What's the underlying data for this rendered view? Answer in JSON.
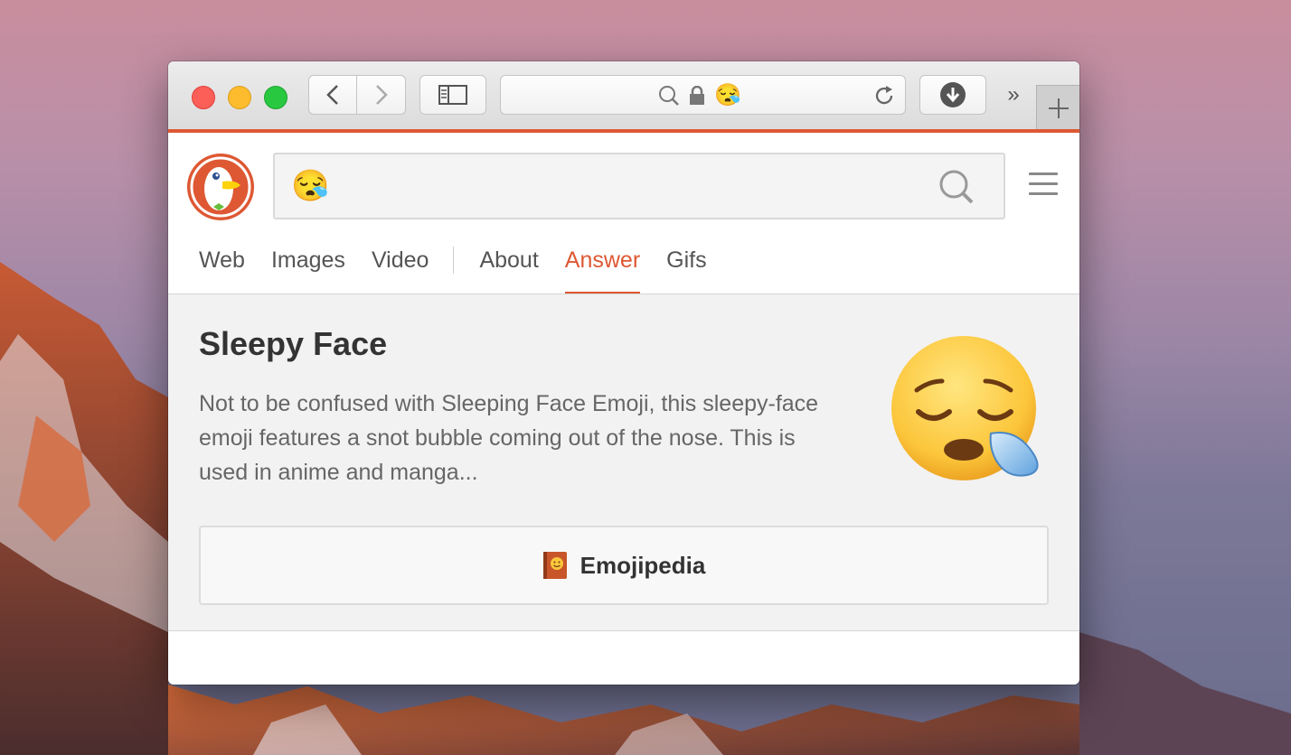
{
  "toolbar": {
    "address_emoji": "😪",
    "overflow_glyph": "»"
  },
  "search": {
    "query": "😪"
  },
  "tabs": [
    {
      "label": "Web",
      "active": false
    },
    {
      "label": "Images",
      "active": false
    },
    {
      "label": "Video",
      "active": false
    },
    {
      "label": "About",
      "active": false
    },
    {
      "label": "Answer",
      "active": true
    },
    {
      "label": "Gifs",
      "active": false
    }
  ],
  "answer": {
    "title": "Sleepy Face",
    "description": "Not to be confused with Sleeping Face Emoji, this sleepy-face emoji features a snot bubble coming out of the nose. This is used in anime and manga...",
    "source_label": "Emojipedia"
  },
  "colors": {
    "accent": "#de5833",
    "traffic_red": "#fc5f57",
    "traffic_yellow": "#fdbc2e",
    "traffic_green": "#28c840"
  }
}
